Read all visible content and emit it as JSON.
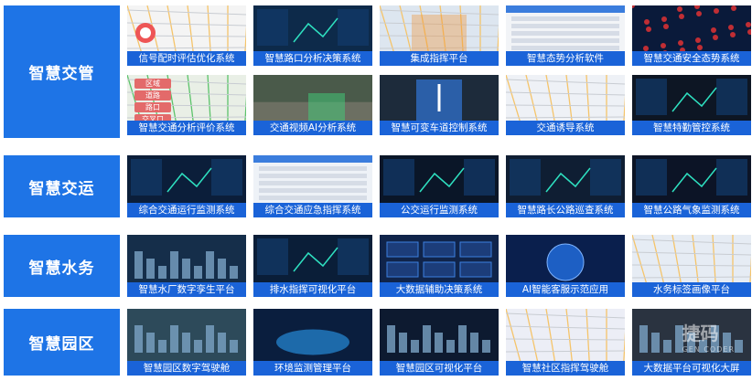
{
  "rows": [
    {
      "category": "智慧交管",
      "items": [
        {
          "label": "信号配时评估优化系统",
          "name": "signal-timing"
        },
        {
          "label": "智慧路口分析决策系统",
          "name": "intersection-decision"
        },
        {
          "label": "集成指挥平台",
          "name": "integrated-command"
        },
        {
          "label": "智慧态势分析软件",
          "name": "situation-analysis"
        },
        {
          "label": "智慧交通安全态势系统",
          "name": "traffic-safety"
        },
        {
          "label": "智慧交通分析评价系统",
          "name": "traffic-evaluation",
          "tags": [
            "区域",
            "道路",
            "路口",
            "交叉口"
          ]
        },
        {
          "label": "交通视频AI分析系统",
          "name": "video-ai"
        },
        {
          "label": "智慧可变车道控制系统",
          "name": "variable-lane"
        },
        {
          "label": "交通诱导系统",
          "name": "traffic-guidance"
        },
        {
          "label": "智慧特勤管控系统",
          "name": "special-duty"
        }
      ]
    },
    {
      "category": "智慧交运",
      "items": [
        {
          "label": "综合交通运行监测系统",
          "name": "transport-monitoring"
        },
        {
          "label": "综合交通应急指挥系统",
          "name": "emergency-command"
        },
        {
          "label": "公交运行监测系统",
          "name": "bus-monitoring"
        },
        {
          "label": "智慧路长公路巡查系统",
          "name": "road-patrol"
        },
        {
          "label": "智慧公路气象监测系统",
          "name": "road-weather"
        }
      ]
    },
    {
      "category": "智慧水务",
      "items": [
        {
          "label": "智慧水厂数字孪生平台",
          "name": "water-twin"
        },
        {
          "label": "排水指挥可视化平台",
          "name": "drainage-command"
        },
        {
          "label": "大数据辅助决策系统",
          "name": "bigdata-decision"
        },
        {
          "label": "AI智能客服示范应用",
          "name": "ai-service"
        },
        {
          "label": "水务标签画像平台",
          "name": "water-tags"
        }
      ]
    },
    {
      "category": "智慧园区",
      "items": [
        {
          "label": "智慧园区数字驾驶舱",
          "name": "park-cockpit"
        },
        {
          "label": "环境监测管理平台",
          "name": "env-monitoring"
        },
        {
          "label": "智慧园区可视化平台",
          "name": "park-visual"
        },
        {
          "label": "智慧社区指挥驾驶舱",
          "name": "community-cockpit"
        },
        {
          "label": "大数据平台可视化大屏",
          "name": "bigdata-screen"
        }
      ]
    }
  ],
  "watermark": {
    "main": "捷码",
    "sub": "GEN CODER"
  },
  "colors": {
    "category_bg": "#1e74e6",
    "caption_bg": "#1a63d8"
  }
}
